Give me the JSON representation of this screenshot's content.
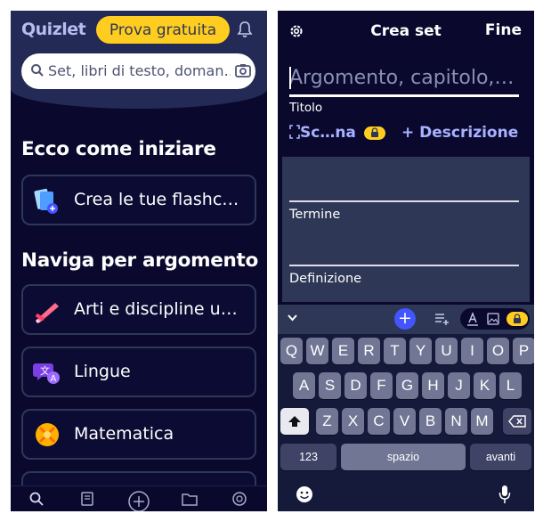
{
  "left": {
    "logo": "Quizlet",
    "trial_button": "Prova gratuita",
    "search_placeholder": "Set, libri di testo, doman…",
    "section_start": "Ecco come iniziare",
    "create_card": "Crea le tue flashc…",
    "section_browse": "Naviga per argomento",
    "topics": [
      "Arti e discipline u…",
      "Lingue",
      "Matematica"
    ]
  },
  "right": {
    "title": "Crea set",
    "done": "Fine",
    "title_placeholder": "Argomento, capitolo,…",
    "title_label": "Titolo",
    "scan": "Sc…na",
    "description": "+ Descrizione",
    "term_label": "Termine",
    "definition_label": "Definizione",
    "keyboard": {
      "row1": [
        "Q",
        "W",
        "E",
        "R",
        "T",
        "Y",
        "U",
        "I",
        "O",
        "P"
      ],
      "row2": [
        "A",
        "S",
        "D",
        "F",
        "G",
        "H",
        "J",
        "K",
        "L"
      ],
      "row3": [
        "Z",
        "X",
        "C",
        "V",
        "B",
        "N",
        "M"
      ],
      "numbers": "123",
      "space": "spazio",
      "enter": "avanti"
    }
  },
  "colors": {
    "bg": "#0a092d",
    "header": "#242a56",
    "accent_yellow": "#ffcd1f",
    "accent_blue": "#4255ff",
    "link": "#a8b1ff",
    "panel": "#2e3856"
  },
  "icons": [
    "bell-icon",
    "search-icon",
    "camera-icon",
    "flashcards-icon",
    "arts-icon",
    "languages-icon",
    "math-icon",
    "home-icon",
    "library-icon",
    "plus-circle-icon",
    "folder-icon",
    "coin-icon",
    "gear-icon",
    "scan-icon",
    "lock-icon",
    "chevron-down-icon",
    "add-list-icon",
    "text-format-icon",
    "image-icon",
    "shift-icon",
    "backspace-icon",
    "emoji-icon",
    "microphone-icon"
  ]
}
